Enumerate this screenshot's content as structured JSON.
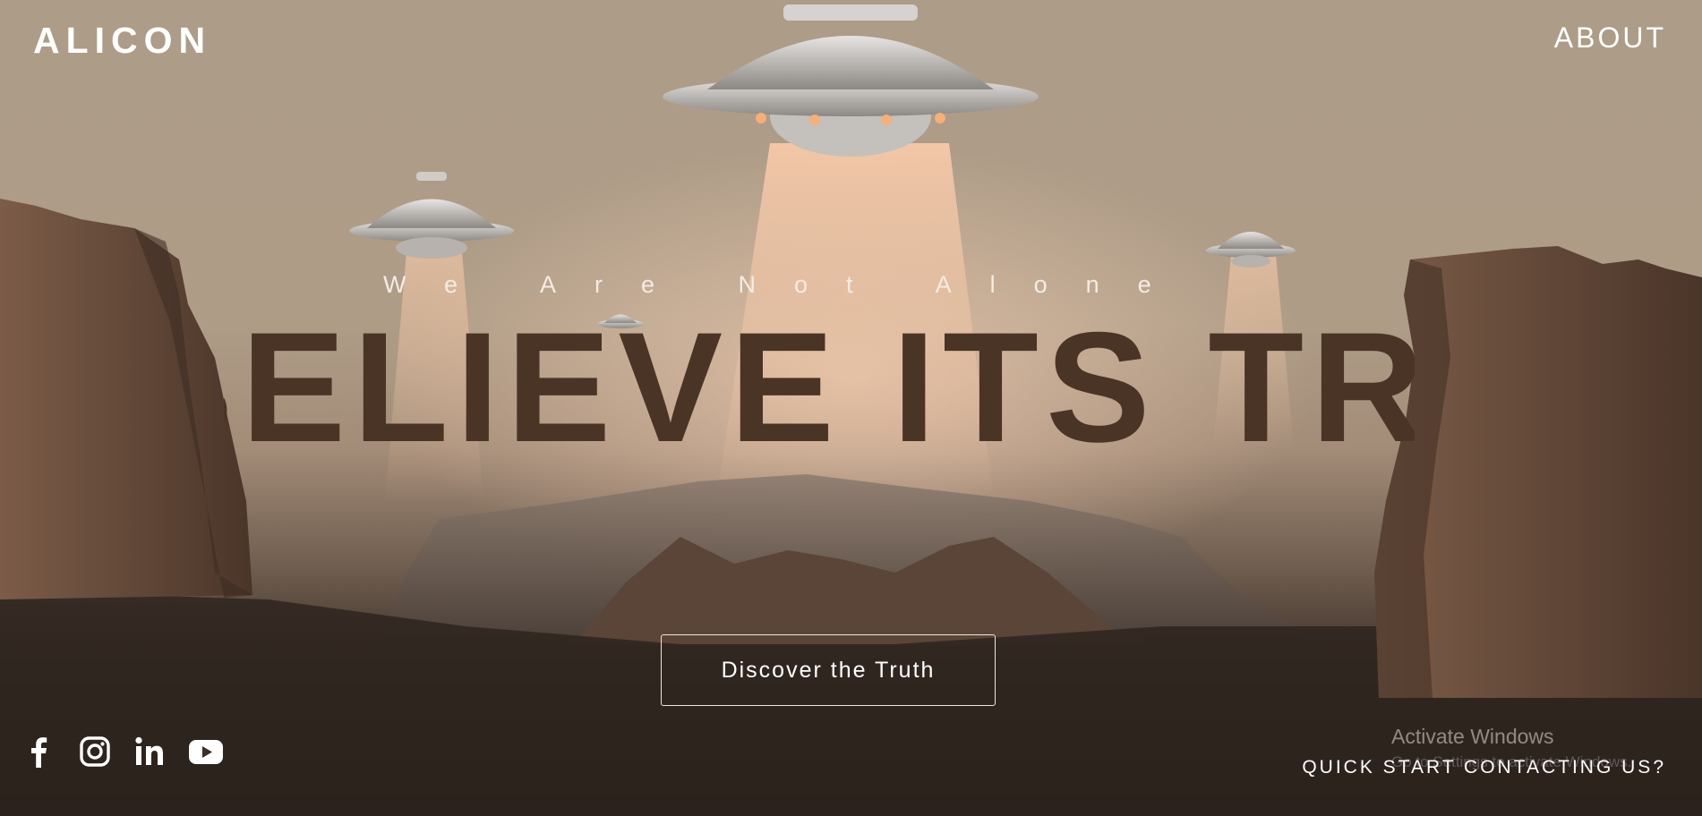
{
  "brand": {
    "logo": "ALICON"
  },
  "nav": {
    "about": "ABOUT"
  },
  "hero": {
    "tagline": "We Are Not Alone",
    "headline": "BELIEVE ITS TRUE",
    "cta": "Discover the Truth"
  },
  "social": [
    {
      "name": "facebook-icon",
      "label": "Facebook"
    },
    {
      "name": "instagram-icon",
      "label": "Instagram"
    },
    {
      "name": "linkedin-icon",
      "label": "LinkedIn"
    },
    {
      "name": "youtube-icon",
      "label": "YouTube"
    }
  ],
  "footer": {
    "contact": "QUICK START CONTACTING US?"
  },
  "watermark": {
    "title": "Activate Windows",
    "subtitle": "Go to Settings to activate Windows."
  },
  "colors": {
    "sky": "#ae9c87",
    "headline": "#4a3426",
    "rock": "#5e4536",
    "ground": "#1e1714",
    "text": "#ffffff"
  }
}
